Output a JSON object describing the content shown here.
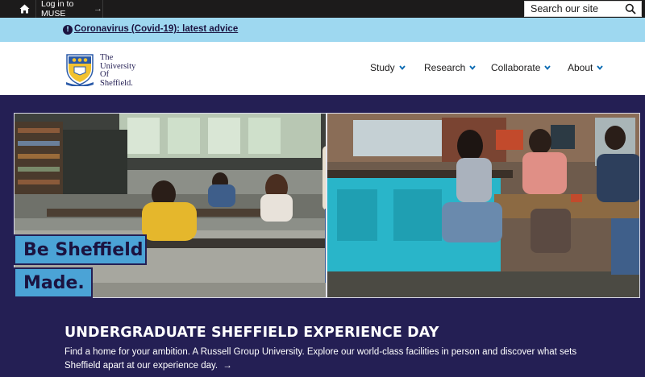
{
  "topbar": {
    "home_icon": "home-icon",
    "login_label": "Log in to MUSE",
    "login_arrow": "→",
    "search_placeholder": "Search our site",
    "search_icon": "search-icon"
  },
  "alert": {
    "icon": "info-icon",
    "icon_glyph": "!",
    "link_text": "Coronavirus (Covid-19): latest advice"
  },
  "header": {
    "logo_lines": [
      "The",
      "University",
      "Of",
      "Sheffield."
    ],
    "nav": [
      {
        "label": "Study"
      },
      {
        "label": "Research"
      },
      {
        "label": "Collaborate"
      },
      {
        "label": "About"
      }
    ]
  },
  "hero": {
    "tag_line1": "Be Sheffield",
    "tag_line2": "Made.",
    "title": "UNDERGRADUATE SHEFFIELD EXPERIENCE DAY",
    "description": "Find a home for your ambition. A Russell Group University. Explore our world-class facilities in person and discover what sets Sheffield apart at our experience day.",
    "cta_arrow": "→"
  },
  "colors": {
    "navy": "#241f54",
    "alert_blue": "#9ed8f0",
    "tag_blue": "#4ba3d6",
    "topbar": "#1c1b1b",
    "chevron": "#0067b1"
  }
}
